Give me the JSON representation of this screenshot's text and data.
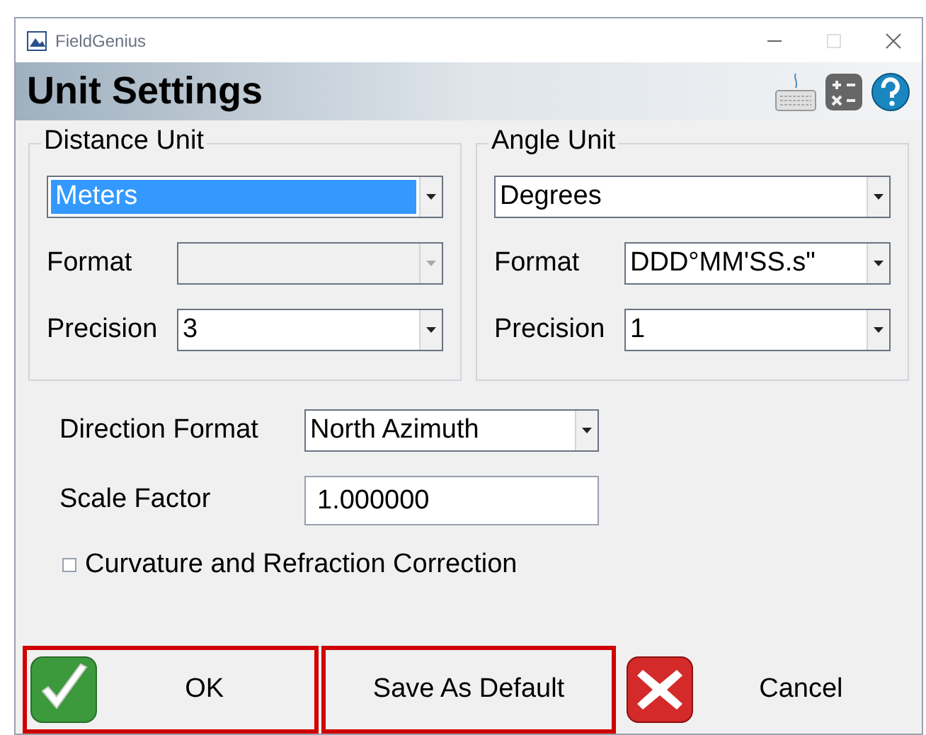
{
  "window": {
    "title": "FieldGenius"
  },
  "header": {
    "title": "Unit Settings"
  },
  "groups": [
    {
      "title": "Distance Unit",
      "unit": {
        "value": "Meters",
        "selected": true
      },
      "fields": [
        {
          "label": "Format",
          "disabled": true
        },
        {
          "label": "Precision",
          "value": "3",
          "disabled": false
        }
      ]
    },
    {
      "title": "Angle Unit",
      "unit": {
        "value": "Degrees",
        "selected": false
      },
      "fields": [
        {
          "label": "Format",
          "value": "DDD°MM'SS.s\"",
          "disabled": false
        },
        {
          "label": "Precision",
          "value": "1",
          "disabled": false
        }
      ]
    }
  ],
  "direction_format": {
    "label": "Direction Format",
    "value": "North Azimuth"
  },
  "scale_factor": {
    "label": "Scale Factor",
    "value": "1.000000"
  },
  "curvature": {
    "label": "Curvature and Refraction Correction",
    "checked": false
  },
  "buttons": [
    {
      "kind": "ok",
      "label": "OK",
      "highlighted": true
    },
    {
      "kind": "plain",
      "label": "Save As Default",
      "highlighted": true
    },
    {
      "kind": "cancel",
      "label": "Cancel",
      "highlighted": false
    }
  ]
}
